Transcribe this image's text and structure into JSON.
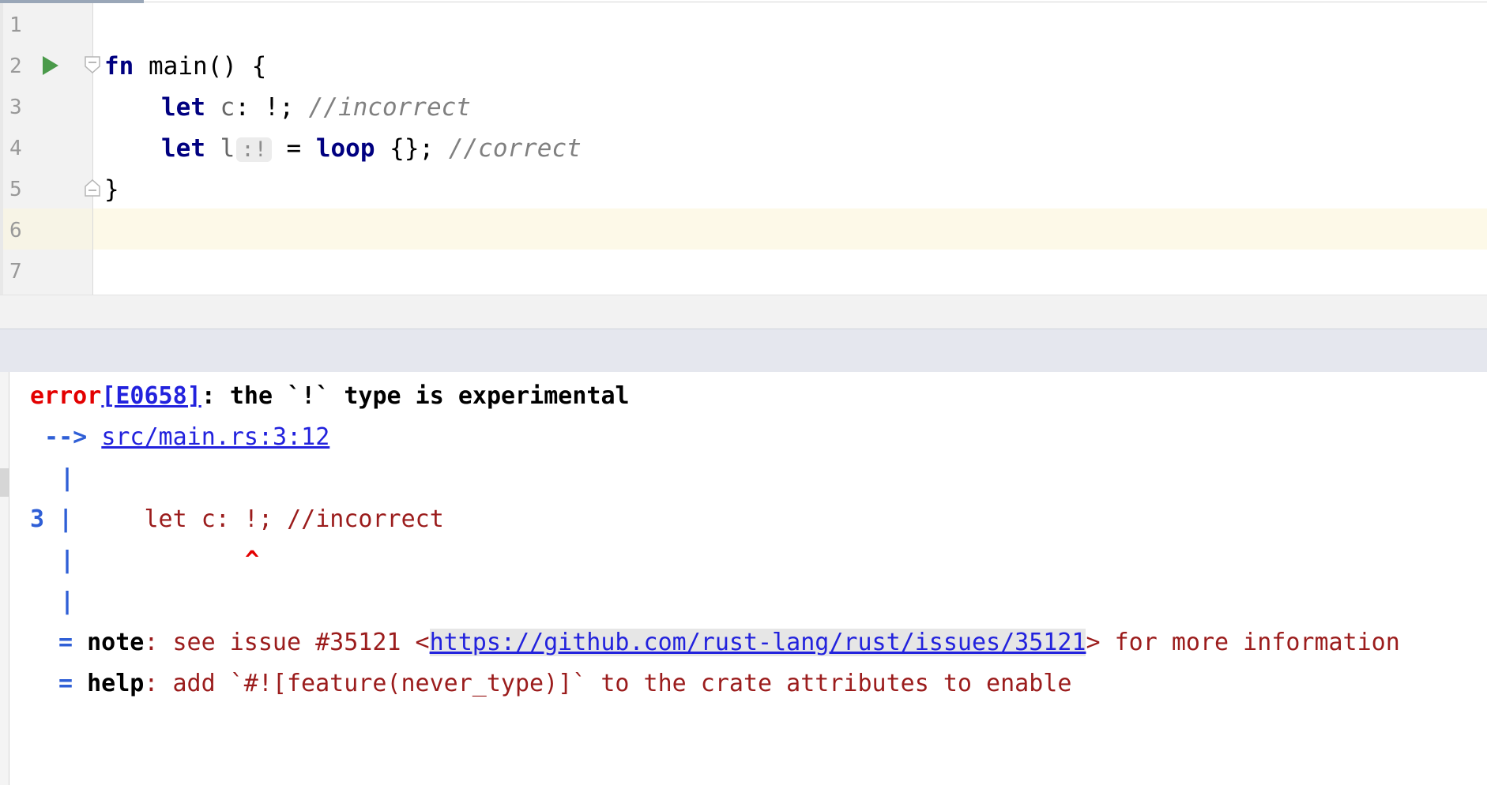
{
  "editor": {
    "line_numbers": [
      "1",
      "2",
      "3",
      "4",
      "5",
      "6",
      "7"
    ],
    "line2": {
      "kw": "fn",
      "rest": " main() {"
    },
    "line3": {
      "kw": "let",
      "var": " c",
      "rest": ": !; ",
      "comment": "//incorrect"
    },
    "line4": {
      "kw": "let",
      "var": " l",
      "inlay": ":!",
      "mid": " = ",
      "kw2": "loop",
      "rest": " {}; ",
      "comment": "//correct"
    },
    "line5": {
      "text": "}"
    },
    "run_icon": "run-triangle-icon",
    "fold_icon": "fold-marker-icon"
  },
  "console": {
    "error": {
      "label": "error",
      "code": "[E0658]",
      "message": ": the `!` type is experimental"
    },
    "location": {
      "arrow": " --> ",
      "path": "src/main.rs:3:12"
    },
    "snippet": {
      "line_no": "3",
      "pipe": "|",
      "code": "    let c: !; //incorrect",
      "caret": "^"
    },
    "note": {
      "eq": "=",
      "label": "note",
      "prefix": ": see issue #35121 <",
      "url": "https://github.com/rust-lang/rust/issues/35121",
      "suffix": "> for more information"
    },
    "help": {
      "eq": "=",
      "label": "help",
      "text": ": add `#![feature(never_type)]` to the crate attributes to enable"
    }
  },
  "colors": {
    "keyword": "#000080",
    "comment": "#808080",
    "error": "#e30000",
    "link": "#2222dd",
    "pipe": "#2f5fd6",
    "console_text": "#9b1c1c",
    "current_line": "#fdf9e8"
  }
}
